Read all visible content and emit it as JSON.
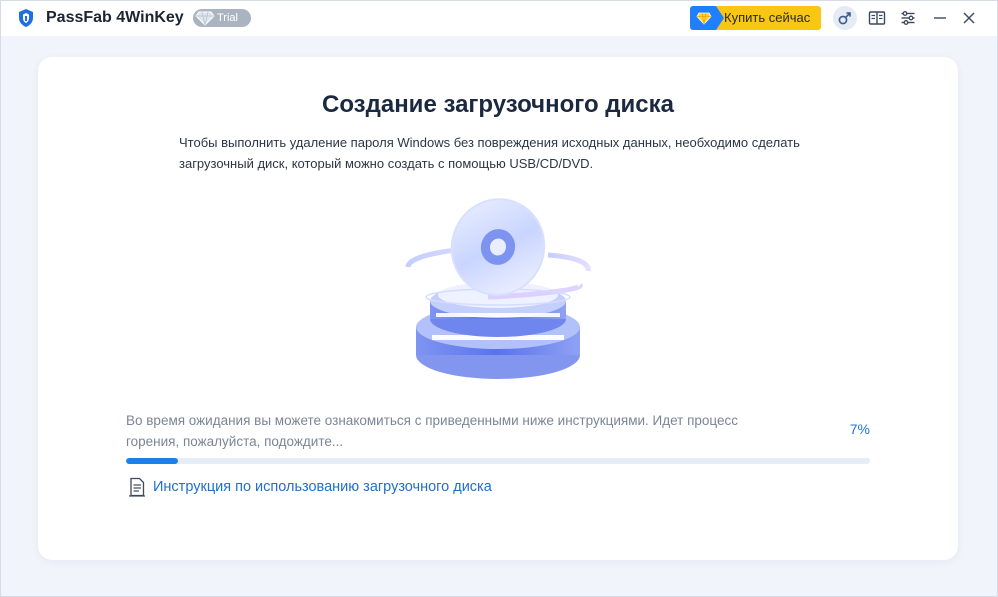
{
  "app": {
    "title": "PassFab 4WinKey",
    "badge": "Trial"
  },
  "toolbar": {
    "buy_label": "Купить сейчас"
  },
  "main": {
    "title": "Создание загрузочного диска",
    "description": "Чтобы выполнить удаление пароля Windows без повреждения исходных данных, необходимо сделать загрузочный диск, который можно создать с помощью USB/CD/DVD.",
    "progress": {
      "message": "Во время ожидания вы можете ознакомиться с приведенными ниже инструкциями. Идет процесс горения, пожалуйста, подождите...",
      "percent_label": "7%",
      "value": 0.07
    },
    "guide_link": "Инструкция по использованию загрузочного диска"
  },
  "icons": {
    "logo": "passfab-shield-icon",
    "trial": "diamond-icon",
    "buy": "diamond-icon",
    "user": "user-gender-icon",
    "guide": "book-icon",
    "settings": "sliders-icon",
    "minimize": "minimize-icon",
    "close": "close-icon",
    "link": "document-icon"
  },
  "colors": {
    "accent": "#1f7fe8",
    "buy_button": "#f9c613",
    "badge": "#aab4c0",
    "background": "#f1f4fa"
  }
}
